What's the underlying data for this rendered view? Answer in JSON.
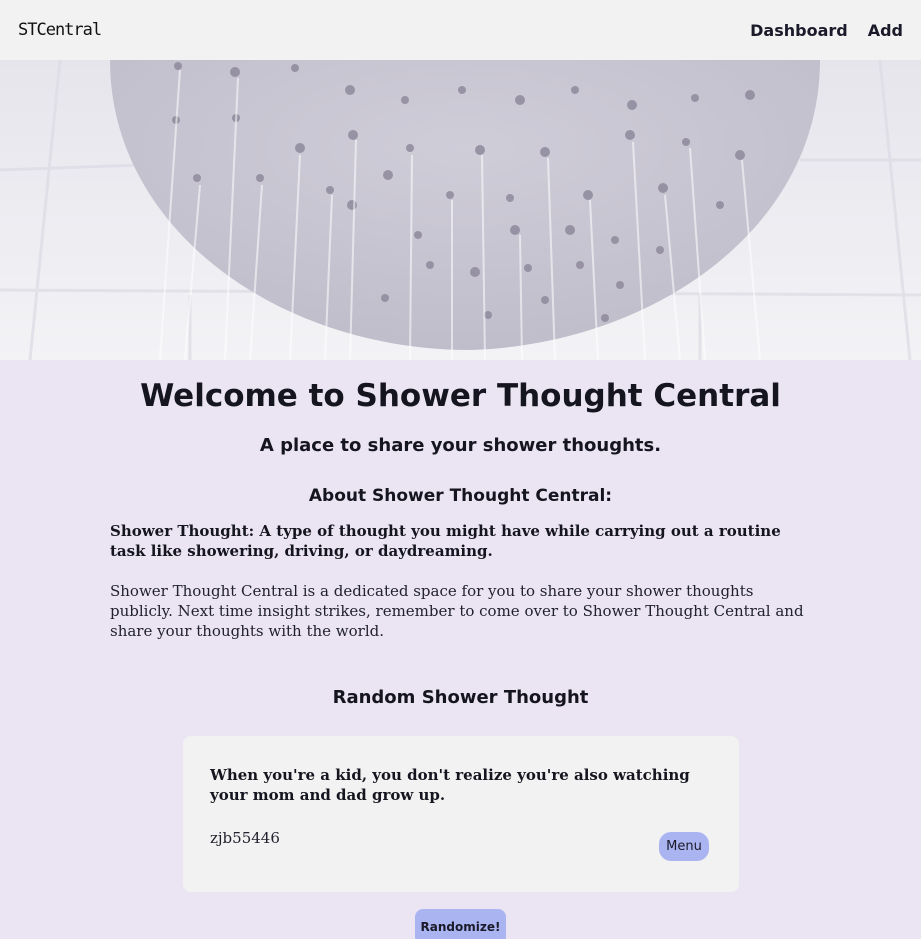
{
  "nav": {
    "brand": "STCentral",
    "links": [
      "Dashboard",
      "Add"
    ]
  },
  "hero": {
    "image": "shower-head-photo"
  },
  "main": {
    "title": "Welcome to Shower Thought Central",
    "subtitle": "A place to share your shower thoughts.",
    "about_heading": "About Shower Thought Central:",
    "definition": "Shower Thought: A type of thought you might have while carrying out a routine task like showering, driving, or daydreaming.",
    "description": "Shower Thought Central is a dedicated space for you to share your shower thoughts publicly. Next time insight strikes, remember to come over to Shower Thought Central and share your thoughts with the world."
  },
  "random": {
    "heading": "Random Shower Thought",
    "thought": "When you're a kid, you don't realize you're also watching your mom and dad grow up.",
    "author": "zjb55446",
    "menu_label": "Menu",
    "randomize_label": "Randomize!"
  },
  "colors": {
    "page_background": "#ebe5f3",
    "navbar_background": "#f2f2f2",
    "card_background": "#f2f2f2",
    "button_accent": "#aab4f0",
    "text": "#15151f"
  }
}
